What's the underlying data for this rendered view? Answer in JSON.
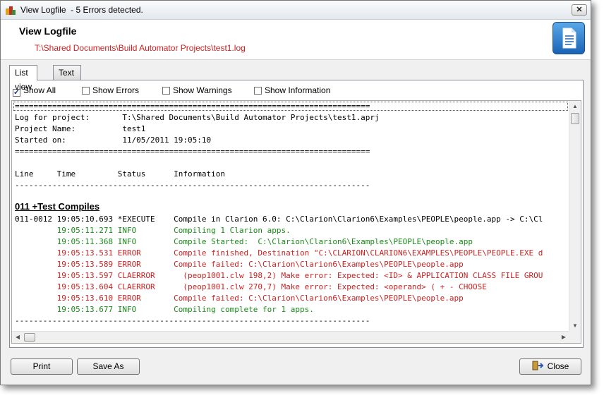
{
  "window": {
    "title": "View Logfile  - 5 Errors detected.",
    "close_glyph": "✕"
  },
  "header": {
    "title": "View Logfile",
    "path": "T:\\Shared Documents\\Build Automator Projects\\test1.log",
    "icon": "document-icon"
  },
  "tabs": [
    {
      "label": "List view",
      "active": true
    },
    {
      "label": "Text view",
      "active": false
    }
  ],
  "filters": [
    {
      "label": "Show All",
      "checked": true
    },
    {
      "label": "Show Errors",
      "checked": false
    },
    {
      "label": "Show Warnings",
      "checked": false
    },
    {
      "label": "Show Information",
      "checked": false
    }
  ],
  "log_lines": [
    {
      "text": "============================================================================",
      "style": "normal"
    },
    {
      "text": "Log for project:       T:\\Shared Documents\\Build Automator Projects\\test1.aprj",
      "style": "normal"
    },
    {
      "text": "Project Name:          test1",
      "style": "normal"
    },
    {
      "text": "Started on:            11/05/2011 19:05:10",
      "style": "normal"
    },
    {
      "text": "============================================================================",
      "style": "normal"
    },
    {
      "text": "",
      "style": "normal"
    },
    {
      "text": "Line     Time         Status      Information",
      "style": "normal"
    },
    {
      "text": "",
      "style": "normal"
    },
    {
      "text": "----------------------------------------------------------------------------",
      "style": "normal"
    },
    {
      "text": "",
      "style": "normal"
    },
    {
      "text": "011 +Test Compiles",
      "style": "heading"
    },
    {
      "text": "011-0012 19:05:10.693 *EXECUTE    Compile in Clarion 6.0: C:\\Clarion\\Clarion6\\Examples\\PEOPLE\\people.app -> C:\\Cl",
      "style": "normal"
    },
    {
      "text": "         19:05:11.271 INFO        Compiling 1 Clarion apps.",
      "style": "green"
    },
    {
      "text": "         19:05:11.368 INFO        Compile Started:  C:\\Clarion\\Clarion6\\Examples\\PEOPLE\\people.app",
      "style": "green"
    },
    {
      "text": "         19:05:13.531 ERROR       Compile finished, Destination \"C:\\CLARION\\CLARION6\\EXAMPLES\\PEOPLE\\PEOPLE.EXE d",
      "style": "red"
    },
    {
      "text": "         19:05:13.589 ERROR       Compile failed: C:\\Clarion\\Clarion6\\Examples\\PEOPLE\\people.app",
      "style": "red"
    },
    {
      "text": "         19:05:13.597 CLAERROR      (peop1001.clw 198,2) Make error: Expected: <ID> & APPLICATION CLASS FILE GROU",
      "style": "red"
    },
    {
      "text": "         19:05:13.604 CLAERROR      (peop1001.clw 270,7) Make error: Expected: <operand> ( + - CHOOSE",
      "style": "red"
    },
    {
      "text": "         19:05:13.610 ERROR       Compile failed: C:\\Clarion\\Clarion6\\Examples\\PEOPLE\\people.app",
      "style": "red"
    },
    {
      "text": "         19:05:13.677 INFO        Compiling complete for 1 apps.",
      "style": "green"
    },
    {
      "text": "",
      "style": "normal"
    },
    {
      "text": "----------------------------------------------------------------------------",
      "style": "normal"
    }
  ],
  "buttons": {
    "print": "Print",
    "save_as": "Save As",
    "close": "Close"
  },
  "colors": {
    "error": "#cc2222",
    "info": "#1a8a1a",
    "accent": "#1a63b5"
  }
}
